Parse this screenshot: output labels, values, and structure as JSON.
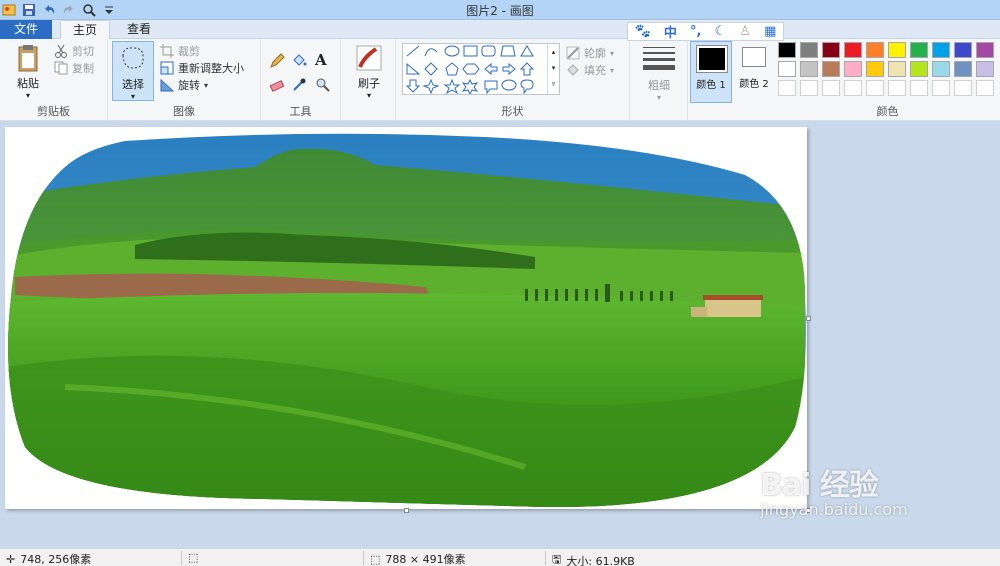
{
  "window": {
    "title": "图片2 - 画图"
  },
  "tabs": {
    "file": "文件",
    "home": "主页",
    "view": "查看"
  },
  "ribbon": {
    "clipboard": {
      "label": "剪贴板",
      "paste": "粘贴",
      "cut": "剪切",
      "copy": "复制"
    },
    "image": {
      "label": "图像",
      "select": "选择",
      "crop": "裁剪",
      "resize": "重新调整大小",
      "rotate": "旋转"
    },
    "tools": {
      "label": "工具"
    },
    "brushes": {
      "label": "刷子"
    },
    "shapes": {
      "label": "形状",
      "outline": "轮廓",
      "fill": "填充"
    },
    "size": {
      "label": "粗细"
    },
    "color1": {
      "label": "颜色 1"
    },
    "color2": {
      "label": "颜色 2"
    },
    "colors": {
      "label": "颜色",
      "palette_row1": [
        "#000000",
        "#7f7f7f",
        "#880015",
        "#ed1c24",
        "#ff7f27",
        "#fff200",
        "#22b14c",
        "#00a2e8",
        "#3f48cc",
        "#a349a4"
      ],
      "palette_row2": [
        "#ffffff",
        "#c3c3c3",
        "#b97a57",
        "#ffaec9",
        "#ffc90e",
        "#efe4b0",
        "#b5e61d",
        "#99d9ea",
        "#7092be",
        "#c8bfe7"
      ]
    }
  },
  "ime": {
    "chinese_mode": "中"
  },
  "status": {
    "cursor_pos": "748, 256像素",
    "image_size": "788 × 491像素",
    "file_size": "大小: 61.9KB"
  },
  "watermark": {
    "main": "Bai 经验",
    "url": "jingyan.baidu.com"
  }
}
